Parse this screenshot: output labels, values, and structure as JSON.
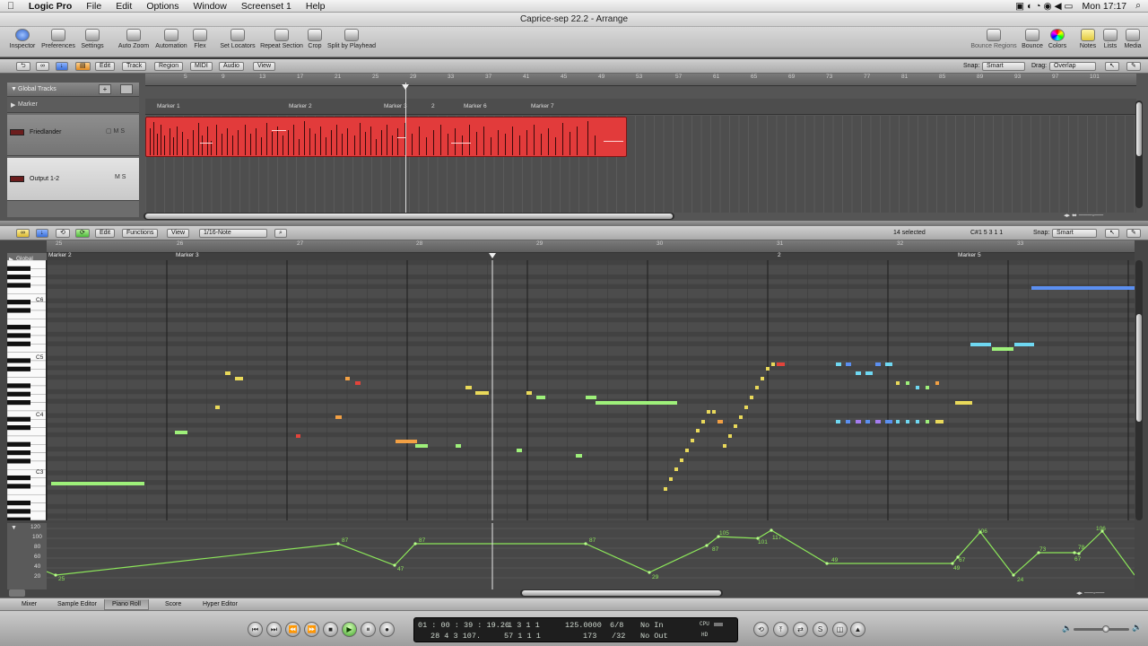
{
  "menubar": {
    "app_name": "Logic Pro",
    "items": [
      "File",
      "Edit",
      "Options",
      "Window",
      "Screenset 1",
      "Help"
    ],
    "clock": "Mon 17:17"
  },
  "window": {
    "title": "Caprice-sep 22.2 - Arrange"
  },
  "toolbar": {
    "left": [
      "Inspector",
      "Preferences",
      "Settings",
      "Auto Zoom",
      "Automation",
      "Flex",
      "Set Locators",
      "Repeat Section",
      "Crop",
      "Split by Playhead"
    ],
    "right": [
      "Bounce Regions",
      "Bounce",
      "Colors",
      "Notes",
      "Lists",
      "Media"
    ]
  },
  "arrange": {
    "menus": [
      "Edit",
      "Track",
      "Region",
      "MIDI",
      "Audio",
      "View"
    ],
    "snap_label": "Snap:",
    "snap_value": "Smart",
    "drag_label": "Drag:",
    "drag_value": "Overlap",
    "ruler_ticks": [
      "5",
      "9",
      "13",
      "17",
      "21",
      "25",
      "29",
      "33",
      "37",
      "41",
      "45",
      "49",
      "53",
      "57",
      "61",
      "65",
      "69",
      "73",
      "77",
      "81",
      "85",
      "89",
      "93",
      "97",
      "101"
    ],
    "global_tracks_label": "Global Tracks",
    "marker_track_label": "Marker",
    "markers": [
      "Marker 1",
      "Marker 2",
      "Marker 3",
      "2",
      "Marker 6",
      "Marker 7"
    ],
    "tracks": [
      {
        "name": "Friedlander",
        "color": "#e23b3b"
      },
      {
        "name": "Output 1-2",
        "color": "#888888"
      }
    ]
  },
  "piano_roll": {
    "menus": [
      "Edit",
      "Functions",
      "View"
    ],
    "quantize": "1/16-Note",
    "selected_count": "14 selected",
    "position_readout": "C#1  5 3 1 1",
    "snap_label": "Snap:",
    "snap_value": "Smart",
    "global_label": "Global",
    "bar_numbers": [
      "25",
      "26",
      "27",
      "28",
      "29",
      "30",
      "31",
      "32",
      "33"
    ],
    "markers": [
      "Marker 2",
      "Marker 3",
      "2",
      "Marker 5"
    ],
    "key_labels": [
      "C6",
      "C5",
      "C4",
      "C3"
    ],
    "velocity_axis": [
      "120",
      "100",
      "80",
      "60",
      "40",
      "20"
    ],
    "velocity_values": [
      "25",
      "87",
      "47",
      "87",
      "87",
      "29",
      "87",
      "105",
      "101",
      "117",
      "49",
      "67",
      "49",
      "106",
      "24",
      "73",
      "78",
      "67",
      "106"
    ]
  },
  "tabs": {
    "items": [
      "Mixer",
      "Sample Editor",
      "Piano Roll",
      "Score",
      "Hyper Editor"
    ],
    "active": "Piano Roll"
  },
  "transport": {
    "smpte": "01 : 00 : 39 : 19.26",
    "bars": "28   4   3  107.",
    "pos1": "1   3   1   1",
    "pos2": "57   1   1   1",
    "tempo": "125.0000",
    "tempo2": "173",
    "sig": "6/8",
    "division": "/32",
    "midi_in": "No In",
    "midi_out": "No Out",
    "cpu_label": "CPU",
    "hd_label": "HD"
  },
  "colors": {
    "region_red": "#e23b3b",
    "note_green": "#9ef07a",
    "note_yellow": "#e9d95a",
    "note_orange": "#f2a044",
    "note_red": "#e2443b",
    "note_cyan": "#6fd8f2",
    "note_blue": "#5b8ff0",
    "note_purple": "#a47cf0",
    "velocity_line": "#8ce65a"
  }
}
